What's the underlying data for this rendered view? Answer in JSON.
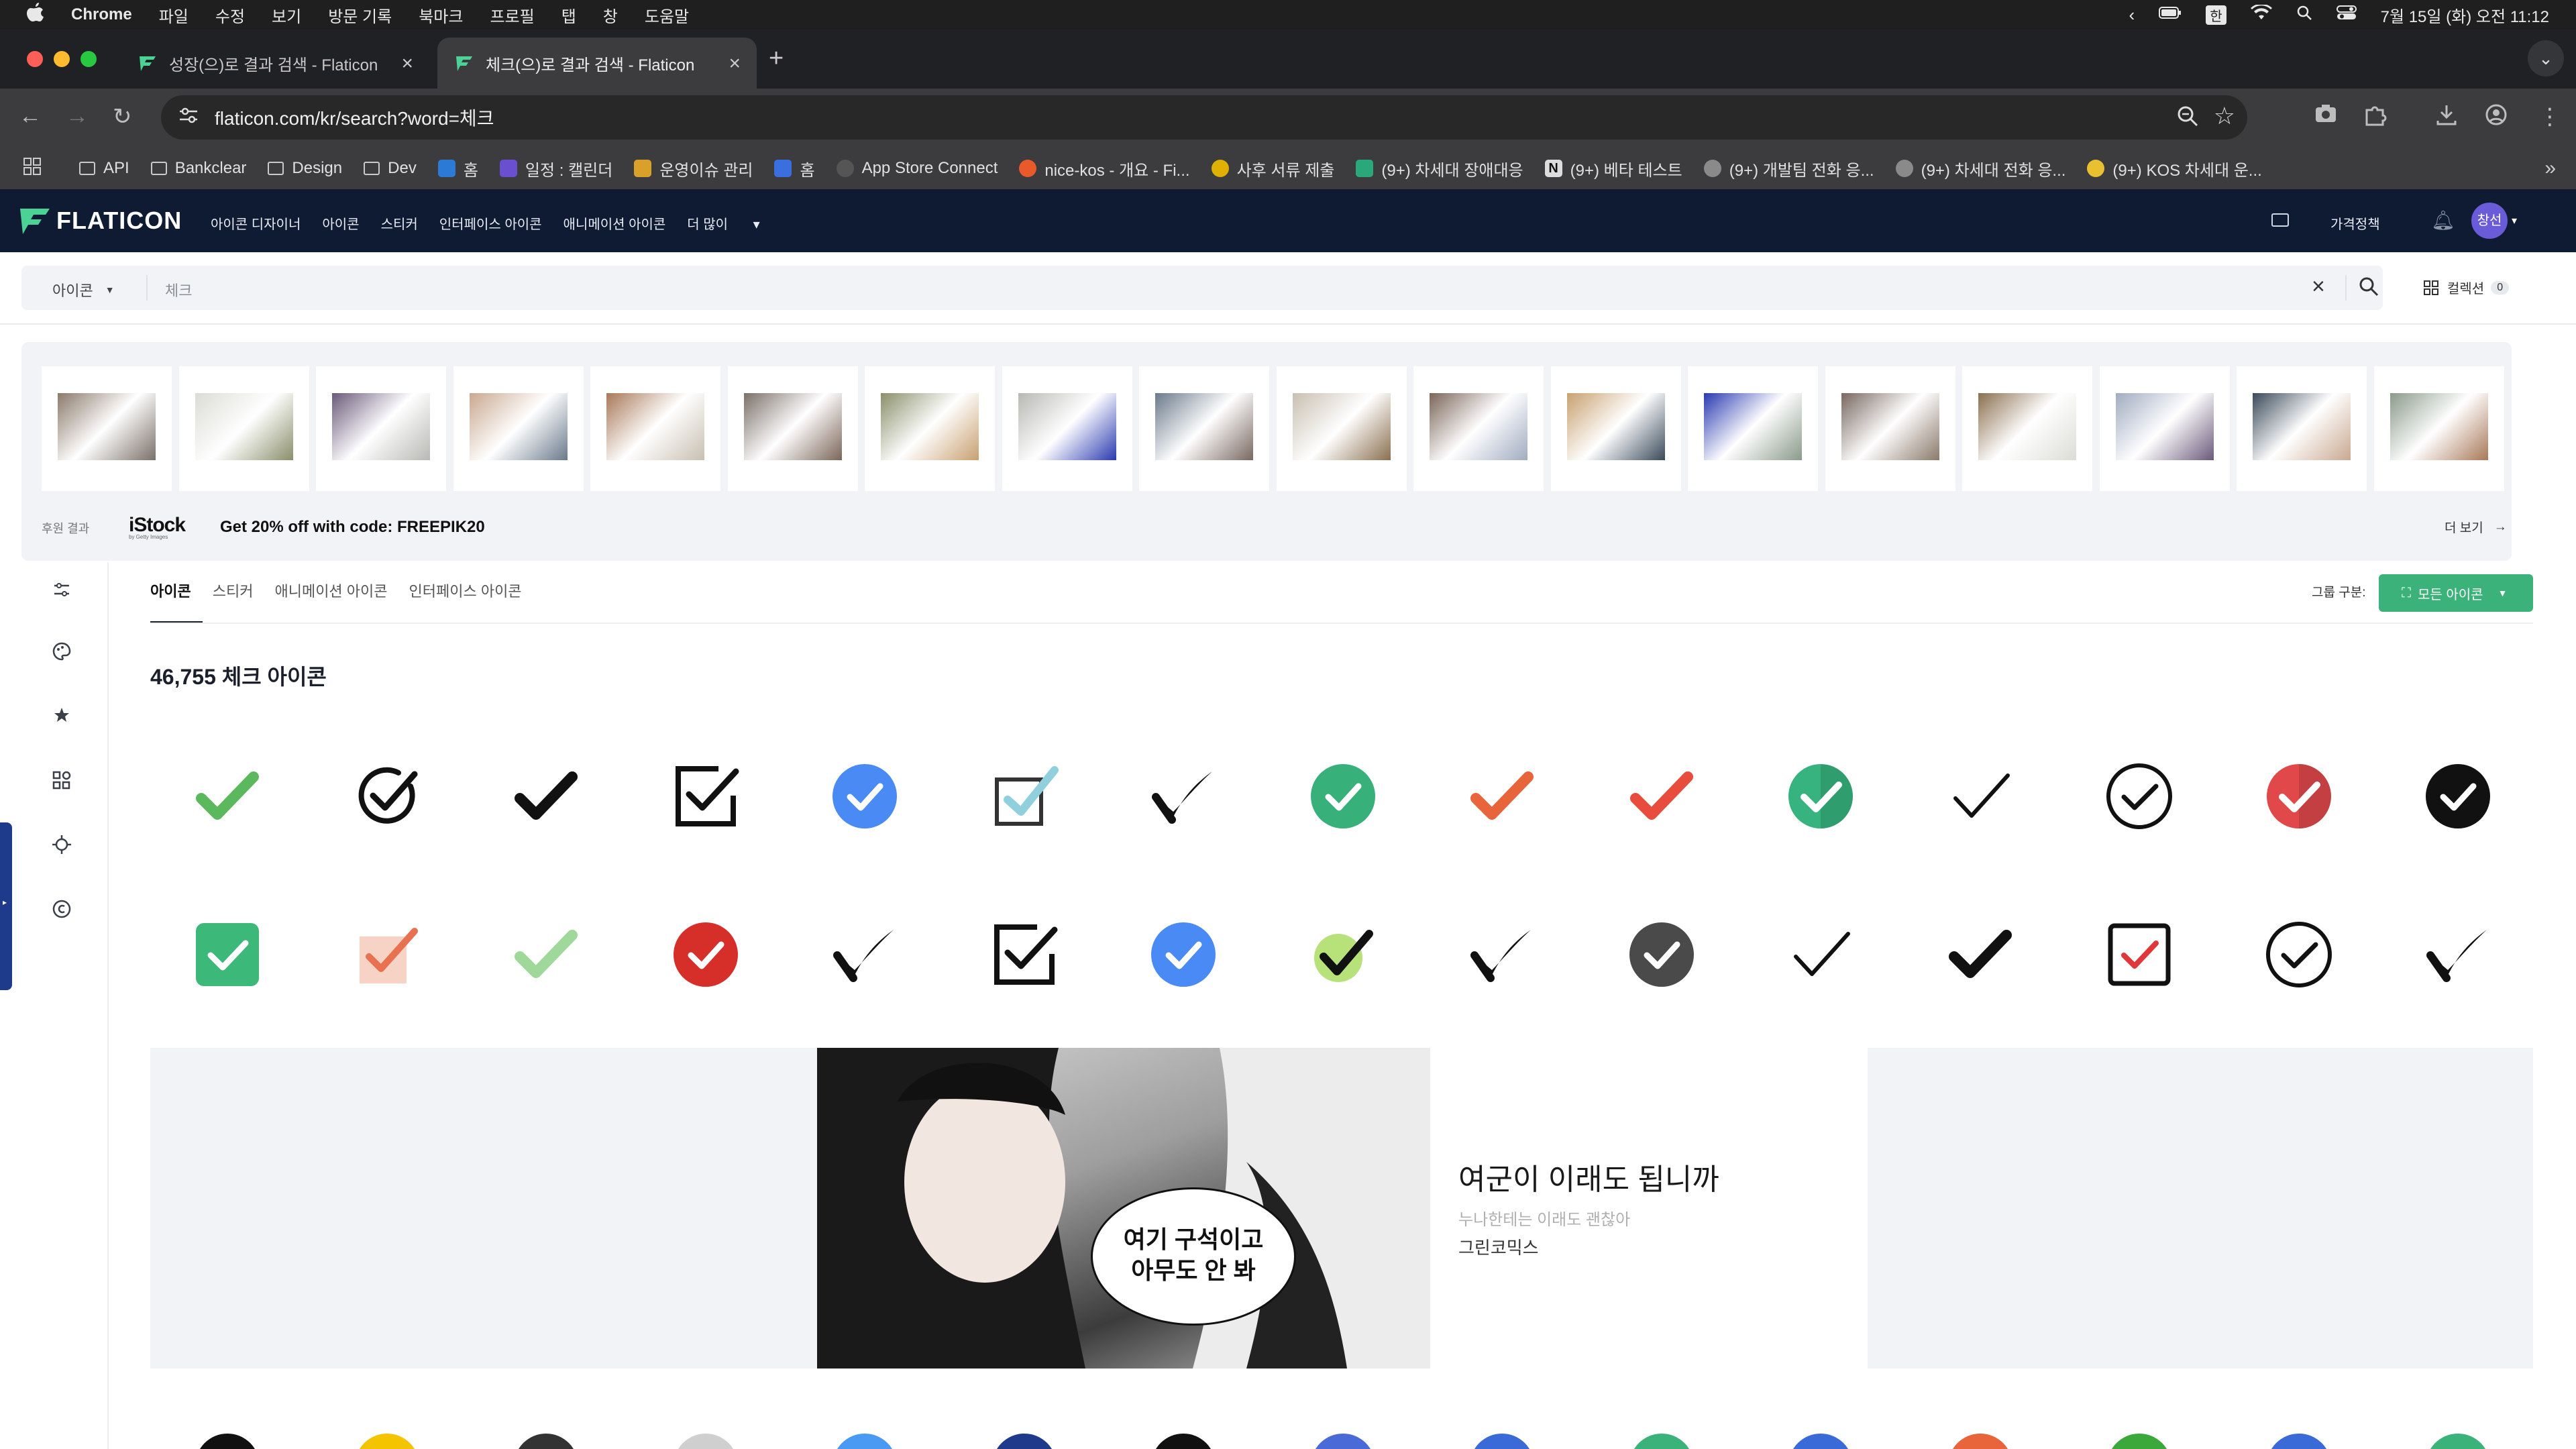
{
  "macos": {
    "apple": "",
    "app": "Chrome",
    "menus": [
      "파일",
      "수정",
      "보기",
      "방문 기록",
      "북마크",
      "프로필",
      "탭",
      "창",
      "도움말"
    ],
    "ime": "한",
    "clock": "7월 15일 (화) 오전 11:12"
  },
  "browser": {
    "tabs": [
      {
        "title": "성장(으)로 결과 검색 - Flaticon"
      },
      {
        "title": "체크(으)로 결과 검색 - Flaticon"
      }
    ],
    "url": "flaticon.com/kr/search?word=체크",
    "bookmarks": [
      {
        "label": "API",
        "kind": "folder"
      },
      {
        "label": "Bankclear",
        "kind": "folder"
      },
      {
        "label": "Design",
        "kind": "folder"
      },
      {
        "label": "Dev",
        "kind": "folder"
      },
      {
        "label": "홈",
        "kind": "app",
        "color": "#2b7bd6"
      },
      {
        "label": "일정 : 캘린더",
        "kind": "app",
        "color": "#6a4fd1"
      },
      {
        "label": "운영이슈 관리",
        "kind": "app",
        "color": "#d9a02a"
      },
      {
        "label": "홈",
        "kind": "app",
        "color": "#3b6fe0"
      },
      {
        "label": "App Store Connect",
        "kind": "app",
        "color": "#555555"
      },
      {
        "label": "nice-kos - 개요 - Fi...",
        "kind": "app",
        "color": "#e85a2a"
      },
      {
        "label": "사후 서류 제출",
        "kind": "app",
        "color": "#e0b000"
      },
      {
        "label": "(9+) 차세대 장애대응",
        "kind": "app",
        "color": "#2aa87a"
      },
      {
        "label": "(9+) 베타 테스트",
        "kind": "app",
        "color": "#dddddd"
      },
      {
        "label": "(9+) 개발팀 전화 응...",
        "kind": "app",
        "color": "#8a8a8a"
      },
      {
        "label": "(9+) 차세대 전화 응...",
        "kind": "app",
        "color": "#8a8a8a"
      },
      {
        "label": "(9+) KOS 차세대 운...",
        "kind": "app",
        "color": "#e8c030"
      }
    ]
  },
  "flaticon": {
    "logo": "FLATICON",
    "nav": [
      "아이콘 디자이너",
      "아이콘",
      "스티커",
      "인터페이스 아이콘",
      "애니메이션 아이콘",
      "더 많이"
    ],
    "pricing": "가격정책",
    "avatar": "창선",
    "search": {
      "type": "아이콘",
      "value": "체크",
      "collections": "컬렉션",
      "collections_count": "0"
    },
    "sponsor": {
      "label": "후원 결과",
      "brand": "iStock",
      "brand_sub": "by Getty Images",
      "promo": "Get 20% off with code: FREEPIK20",
      "more": "더 보기"
    },
    "tabs": [
      "아이콘",
      "스티커",
      "애니메이션 아이콘",
      "인터페이스 아이콘"
    ],
    "group_label": "그룹 구분:",
    "group_button": "모든 아이콘",
    "result_count": "46,755 체크 아이콘"
  },
  "ad": {
    "bubble_line1": "여기 구석이고",
    "bubble_line2": "아무도 안 봐",
    "title": "여군이 이래도 됩니까",
    "subtitle": "누나한테는 이래도 괜찮아",
    "brand": "그린코믹스"
  },
  "colors": {
    "accent_green": "#3bb27a",
    "header_navy": "#0f1a33",
    "check_green": "#5cb85c",
    "check_blue": "#4a8af4",
    "check_red": "#e74c3c"
  }
}
